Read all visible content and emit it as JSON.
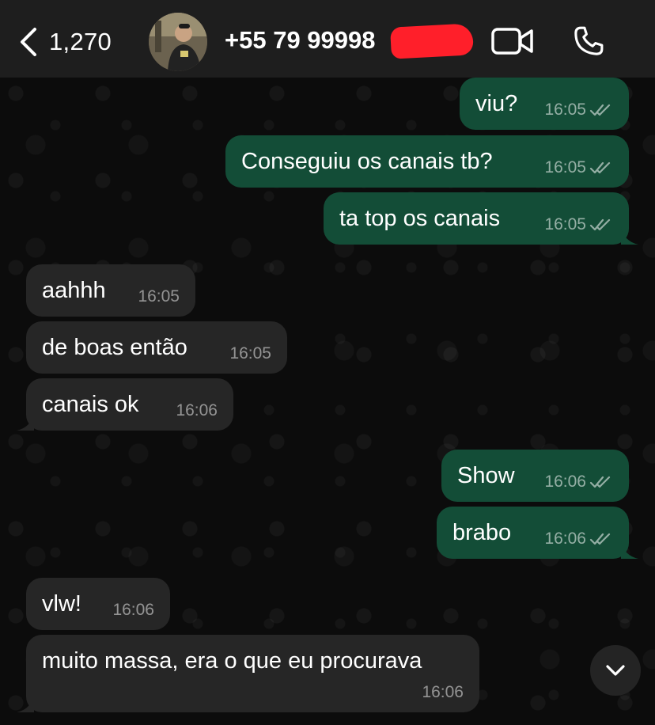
{
  "header": {
    "back_count": "1,270",
    "contact_name": "+55 79 99998",
    "colors": {
      "background": "#1e1e1e",
      "redaction": "#ff1f2a"
    }
  },
  "messages": [
    {
      "direction": "outgoing",
      "text": "viu?",
      "time": "16:05",
      "status": "read"
    },
    {
      "direction": "outgoing",
      "text": "Conseguiu os canais tb?",
      "time": "16:05",
      "status": "read"
    },
    {
      "direction": "outgoing",
      "text": "ta top os canais",
      "time": "16:05",
      "status": "read"
    },
    {
      "direction": "incoming",
      "text": "aahhh",
      "time": "16:05"
    },
    {
      "direction": "incoming",
      "text": "de boas então",
      "time": "16:05"
    },
    {
      "direction": "incoming",
      "text": "canais ok",
      "time": "16:06"
    },
    {
      "direction": "outgoing",
      "text": "Show",
      "time": "16:06",
      "status": "read"
    },
    {
      "direction": "outgoing",
      "text": "brabo",
      "time": "16:06",
      "status": "read"
    },
    {
      "direction": "incoming",
      "text": "vlw!",
      "time": "16:06"
    },
    {
      "direction": "incoming",
      "text": "muito massa, era o que eu procurava",
      "time": "16:06"
    }
  ],
  "icons": {
    "back": "chevron-left-icon",
    "video_call": "video-camera-icon",
    "voice_call": "phone-icon",
    "read_receipt": "double-check-icon",
    "scroll_down": "chevron-down-icon"
  },
  "colors": {
    "outgoing_bubble": "#134d37",
    "incoming_bubble": "#262626",
    "chat_background": "#0c0c0c"
  }
}
